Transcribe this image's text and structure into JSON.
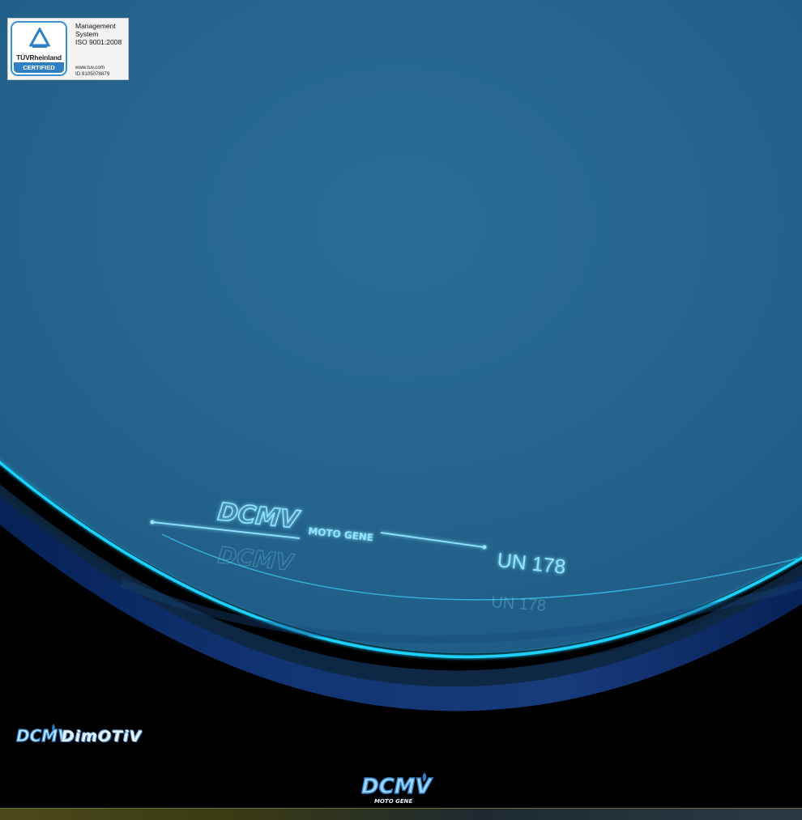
{
  "certification": {
    "brand": "TÜVRheinland",
    "registered_mark": "®",
    "badge_label": "CERTIFIED",
    "line1": "Management",
    "line2": "System",
    "line3": "ISO 9001:2008",
    "website": "www.tuv.com",
    "id": "ID  9105078879"
  },
  "lens": {
    "etched_logo": "DCMV",
    "etched_tagline": "MOTO GENE",
    "standard_mark": "UN 178",
    "reflection_mark": "UN 178"
  },
  "branding": {
    "corner_logo": "DCMV",
    "corner_wordmark": "DimOTiV",
    "bottom_logo": "DCMV",
    "bottom_tagline": "MOTO GENE"
  },
  "colors": {
    "lens_fill": "#24638c",
    "lens_edge_glow": "#1fd0ff",
    "background": "#000000",
    "etch": "#8fe7ff",
    "brand_blue": "#2f7fc6"
  }
}
